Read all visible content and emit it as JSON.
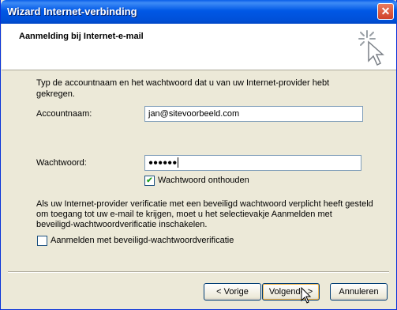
{
  "window": {
    "title": "Wizard Internet-verbinding",
    "close_label": "✕"
  },
  "header": {
    "title": "Aanmelding bij Internet-e-mail"
  },
  "content": {
    "intro_line1": "Typ de accountnaam en het wachtwoord dat u van uw Internet-provider hebt",
    "intro_line2": "gekregen.",
    "account_label": "Accountnaam:",
    "account_value": "jan@sitevoorbeeld.com",
    "password_label": "Wachtwoord:",
    "password_value": "●●●●●●",
    "remember_label": "Wachtwoord onthouden",
    "remember_checked": true,
    "spa_text_line1": "Als uw Internet-provider verificatie met een beveiligd wachtwoord verplicht heeft gesteld",
    "spa_text_line2": "om toegang tot uw e-mail te krijgen, moet u het selectievakje Aanmelden met",
    "spa_text_line3": "beveiligd-wachtwoordverificatie inschakelen.",
    "spa_label": "Aanmelden met beveiligd-wachtwoordverificatie",
    "spa_checked": false
  },
  "buttons": {
    "back": "< Vorige",
    "next": "Volgende >",
    "cancel": "Annuleren"
  },
  "colors": {
    "titlebar": "#0058e6",
    "dialog_bg": "#ece9d8",
    "check_green": "#21a121"
  }
}
